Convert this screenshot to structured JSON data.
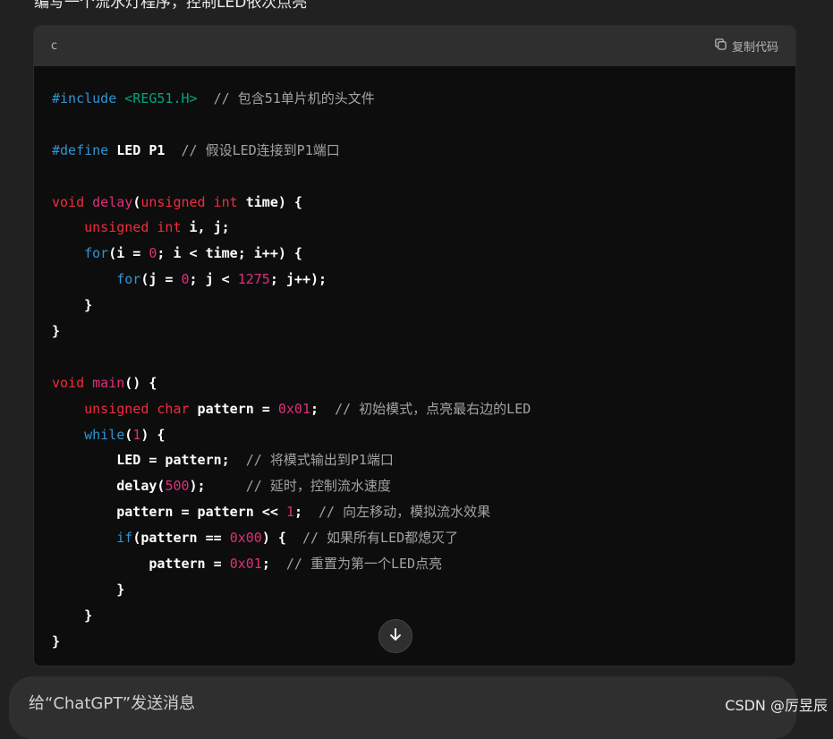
{
  "top_text": "编写一个流水灯程序，控制LED依次点亮",
  "code_block": {
    "language": "c",
    "copy_label": "复制代码",
    "copy_icon": "copy-icon",
    "lines": [
      [
        [
          "kw",
          "#include"
        ],
        [
          "pl",
          " "
        ],
        [
          "str",
          "<REG51.H>"
        ],
        [
          "pl",
          "  "
        ],
        [
          "cm",
          "// 包含51单片机的头文件"
        ]
      ],
      [],
      [
        [
          "kw",
          "#define"
        ],
        [
          "pl",
          " LED P1  "
        ],
        [
          "cm",
          "// 假设LED连接到P1端口"
        ]
      ],
      [],
      [
        [
          "ty",
          "void"
        ],
        [
          "pl",
          " "
        ],
        [
          "fn",
          "delay"
        ],
        [
          "pl",
          "("
        ],
        [
          "ty",
          "unsigned"
        ],
        [
          "pl",
          " "
        ],
        [
          "ty",
          "int"
        ],
        [
          "pl",
          " time) {"
        ]
      ],
      [
        [
          "pl",
          "    "
        ],
        [
          "ty",
          "unsigned"
        ],
        [
          "pl",
          " "
        ],
        [
          "ty",
          "int"
        ],
        [
          "pl",
          " i, j;"
        ]
      ],
      [
        [
          "pl",
          "    "
        ],
        [
          "kw",
          "for"
        ],
        [
          "pl",
          "(i = "
        ],
        [
          "num",
          "0"
        ],
        [
          "pl",
          "; i < time; i++) {"
        ]
      ],
      [
        [
          "pl",
          "        "
        ],
        [
          "kw",
          "for"
        ],
        [
          "pl",
          "(j = "
        ],
        [
          "num",
          "0"
        ],
        [
          "pl",
          "; j < "
        ],
        [
          "num",
          "1275"
        ],
        [
          "pl",
          "; j++);"
        ]
      ],
      [
        [
          "pl",
          "    }"
        ]
      ],
      [
        [
          "pl",
          "}"
        ]
      ],
      [],
      [
        [
          "ty",
          "void"
        ],
        [
          "pl",
          " "
        ],
        [
          "fn",
          "main"
        ],
        [
          "pl",
          "() {"
        ]
      ],
      [
        [
          "pl",
          "    "
        ],
        [
          "ty",
          "unsigned"
        ],
        [
          "pl",
          " "
        ],
        [
          "ty",
          "char"
        ],
        [
          "pl",
          " pattern = "
        ],
        [
          "num",
          "0x01"
        ],
        [
          "pl",
          ";  "
        ],
        [
          "cm",
          "// 初始模式，点亮最右边的LED"
        ]
      ],
      [
        [
          "pl",
          "    "
        ],
        [
          "kw",
          "while"
        ],
        [
          "pl",
          "("
        ],
        [
          "num",
          "1"
        ],
        [
          "pl",
          ") {"
        ]
      ],
      [
        [
          "pl",
          "        LED = pattern;  "
        ],
        [
          "cm",
          "// 将模式输出到P1端口"
        ]
      ],
      [
        [
          "pl",
          "        delay("
        ],
        [
          "num",
          "500"
        ],
        [
          "pl",
          ");     "
        ],
        [
          "cm",
          "// 延时，控制流水速度"
        ]
      ],
      [
        [
          "pl",
          "        pattern = pattern << "
        ],
        [
          "num",
          "1"
        ],
        [
          "pl",
          ";  "
        ],
        [
          "cm",
          "// 向左移动，模拟流水效果"
        ]
      ],
      [
        [
          "pl",
          "        "
        ],
        [
          "kw",
          "if"
        ],
        [
          "pl",
          "(pattern == "
        ],
        [
          "num",
          "0x00"
        ],
        [
          "pl",
          ") {  "
        ],
        [
          "cm",
          "// 如果所有LED都熄灭了"
        ]
      ],
      [
        [
          "pl",
          "            pattern = "
        ],
        [
          "num",
          "0x01"
        ],
        [
          "pl",
          ";  "
        ],
        [
          "cm",
          "// 重置为第一个LED点亮"
        ]
      ],
      [
        [
          "pl",
          "        }"
        ]
      ],
      [
        [
          "pl",
          "    }"
        ]
      ],
      [
        [
          "pl",
          "}"
        ]
      ]
    ]
  },
  "scroll_down_icon": "arrow-down-icon",
  "input": {
    "placeholder": "给“ChatGPT”发送消息"
  },
  "watermark": "CSDN @厉昱辰"
}
